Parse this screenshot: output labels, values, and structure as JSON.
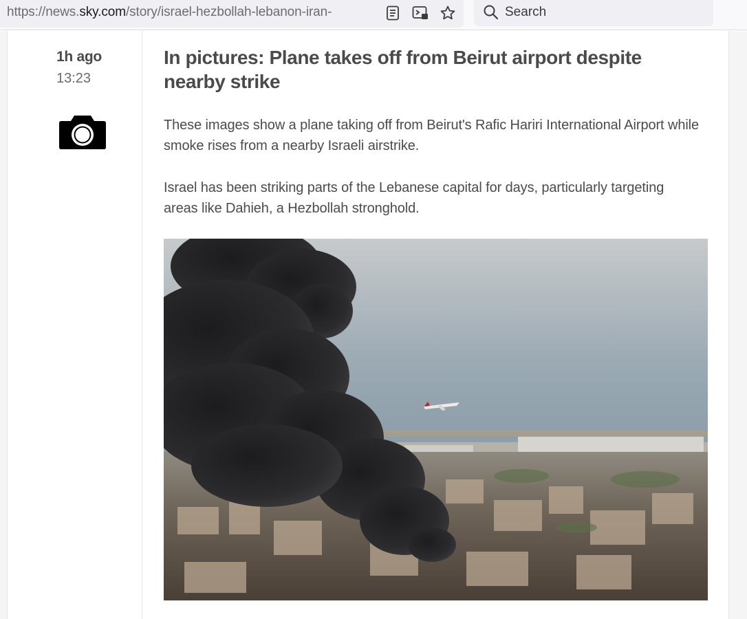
{
  "browser": {
    "url_scheme": "https://news.",
    "url_domain": "sky.com",
    "url_path": "/story/israel-hezbollah-lebanon-iran-",
    "search_label": "Search"
  },
  "post": {
    "time_relative": "1h ago",
    "time_absolute": "13:23",
    "headline": "In pictures: Plane takes off from Beirut airport despite nearby strike",
    "paragraphs": [
      "These images show a plane taking off from Beirut's Rafic Hariri International Airport while smoke rises from a nearby Israeli airstrike.",
      "Israel has been striking parts of the Lebanese capital for days, particularly targeting areas like Dahieh, a Hezbollah stronghold."
    ],
    "media_icon": "camera-icon"
  },
  "icons": {
    "reader": "reader-view-icon",
    "pip": "picture-in-picture-icon",
    "bookmark": "star-icon",
    "search": "search-icon"
  }
}
